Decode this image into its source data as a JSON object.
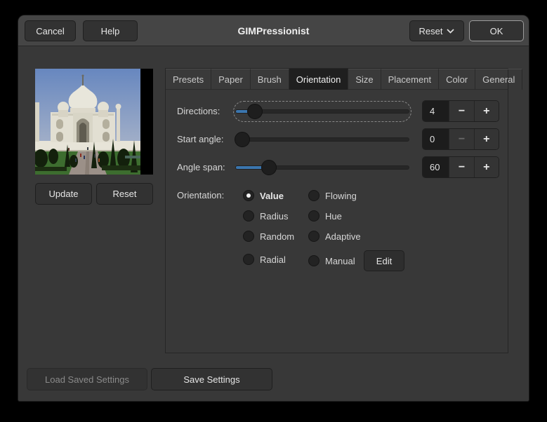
{
  "window": {
    "title": "GIMPressionist",
    "header": {
      "cancel": "Cancel",
      "help": "Help",
      "reset": "Reset",
      "ok": "OK"
    },
    "icons": {
      "reset_dropdown": "chevron-down-icon"
    }
  },
  "preview_panel": {
    "image_name": "taj-mahal-preview",
    "update_label": "Update",
    "reset_label": "Reset"
  },
  "tabs": [
    {
      "label": "Presets",
      "selected": false
    },
    {
      "label": "Paper",
      "selected": false
    },
    {
      "label": "Brush",
      "selected": false
    },
    {
      "label": "Orientation",
      "selected": true
    },
    {
      "label": "Size",
      "selected": false
    },
    {
      "label": "Placement",
      "selected": false
    },
    {
      "label": "Color",
      "selected": false
    },
    {
      "label": "General",
      "selected": false
    }
  ],
  "orientation_tab": {
    "sliders": [
      {
        "label": "Directions:",
        "value": "4",
        "fraction": 0.08,
        "focused": true,
        "minus_enabled": true,
        "minus_icon": "minus-icon",
        "plus_icon": "plus-icon"
      },
      {
        "label": "Start angle:",
        "value": "0",
        "fraction": 0.0,
        "focused": false,
        "minus_enabled": false,
        "minus_icon": "minus-icon",
        "plus_icon": "plus-icon"
      },
      {
        "label": "Angle span:",
        "value": "60",
        "fraction": 0.167,
        "focused": false,
        "minus_enabled": true,
        "minus_icon": "minus-icon",
        "plus_icon": "plus-icon"
      }
    ],
    "orientation_label": "Orientation:",
    "radios": [
      {
        "label": "Value",
        "selected": true
      },
      {
        "label": "Radius",
        "selected": false
      },
      {
        "label": "Random",
        "selected": false
      },
      {
        "label": "Radial",
        "selected": false
      },
      {
        "label": "Flowing",
        "selected": false
      },
      {
        "label": "Hue",
        "selected": false
      },
      {
        "label": "Adaptive",
        "selected": false
      },
      {
        "label": "Manual",
        "selected": false
      }
    ],
    "edit_label": "Edit"
  },
  "footer": {
    "load_label": "Load Saved Settings",
    "load_enabled": false,
    "save_label": "Save Settings"
  },
  "colors": {
    "headerbar": "#454545",
    "dialog_bg": "#383838",
    "selected_tab_bg": "#1f1f1f",
    "entry_bg": "#1c1c1c",
    "slider_fill": "#3b76ae",
    "ok_border": "#9c9c9c",
    "disabled_text": "#8a8a8a"
  }
}
